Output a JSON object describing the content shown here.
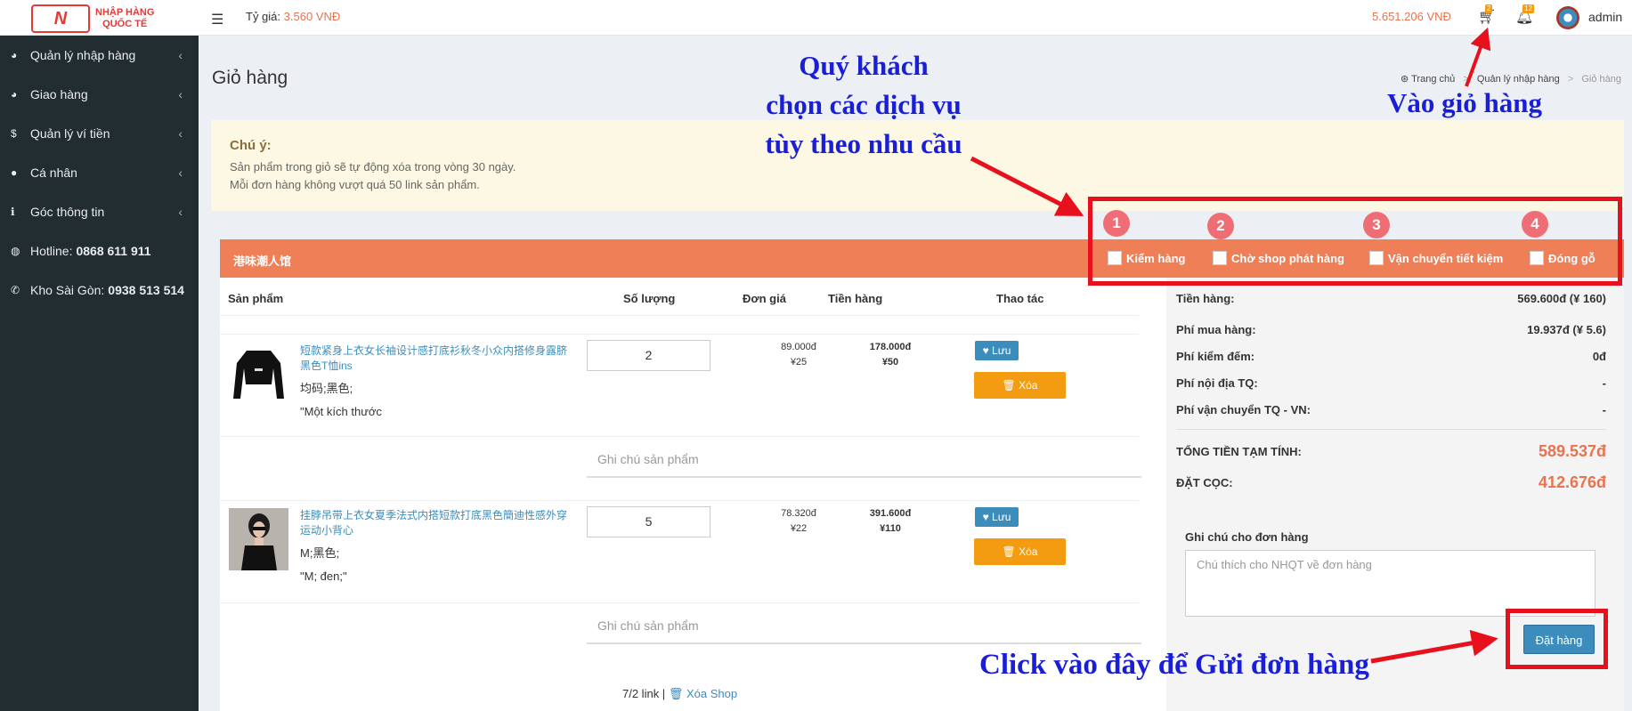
{
  "topbar": {
    "logo_mark": "N",
    "logo_text_line1": "NHẬP HÀNG",
    "logo_text_line2": "QUỐC TẾ",
    "rate_label": "Tỷ giá:",
    "rate_value": "3.560 VNĐ",
    "balance": "5.651.206 VNĐ",
    "cart_count": "2",
    "notif_count": "12",
    "user": "admin"
  },
  "sidebar": {
    "items": [
      {
        "icon": "chart-pie-icon",
        "label": "Quản lý nhập hàng",
        "glyph": "◕"
      },
      {
        "icon": "chart-pie-icon",
        "label": "Giao hàng",
        "glyph": "◕"
      },
      {
        "icon": "dollar-icon",
        "label": "Quản lý ví tiền",
        "glyph": "$"
      },
      {
        "icon": "user-icon",
        "label": "Cá nhân",
        "glyph": "●"
      },
      {
        "icon": "info-icon",
        "label": "Góc thông tin",
        "glyph": "ℹ"
      }
    ],
    "hotline_label": "Hotline:",
    "hotline_value": "0868 611 911",
    "kho_label": "Kho Sài Gòn:",
    "kho_value": "0938 513 514"
  },
  "page": {
    "title": "Giỏ hàng",
    "breadcrumb": [
      "Trang chủ",
      "Quản lý nhập hàng",
      "Giỏ hàng"
    ]
  },
  "notice": {
    "title": "Chú ý:",
    "line1": "Sản phẩm trong giỏ sẽ tự động xóa trong vòng 30 ngày.",
    "line2": "Mỗi đơn hàng không vượt quá 50 link sản phẩm."
  },
  "shop": {
    "name": "港味潮人馆",
    "services": [
      "Kiểm hàng",
      "Chờ shop phát hàng",
      "Vận chuyển tiết kiệm",
      "Đóng gỗ"
    ]
  },
  "table": {
    "headers": [
      "Sản phẩm",
      "Số lượng",
      "Đơn giá",
      "Tiền hàng",
      "Thao tác"
    ]
  },
  "items": [
    {
      "name": "短款紧身上衣女长袖设计感打底衫秋冬小众内搭修身露脐黑色T恤ins",
      "attr": "均码;黑色;",
      "note": "\"Một kích thước",
      "qty": "2",
      "price_vnd": "89.000đ",
      "price_cny": "¥25",
      "total_vnd": "178.000đ",
      "total_cny": "¥50",
      "save_label": "Lưu",
      "delete_label": "Xóa",
      "note_placeholder": "Ghi chú sản phẩm"
    },
    {
      "name": "挂脖吊带上衣女夏季法式内搭短款打底黑色簡迪性感外穿运动小背心",
      "attr": "M;黑色;",
      "note": "\"M; đen;\"",
      "qty": "5",
      "price_vnd": "78.320đ",
      "price_cny": "¥22",
      "total_vnd": "391.600đ",
      "total_cny": "¥110",
      "save_label": "Lưu",
      "delete_label": "Xóa",
      "note_placeholder": "Ghi chú sản phẩm"
    }
  ],
  "footer": {
    "links": "7/2 link |",
    "delete_shop": "Xóa Shop"
  },
  "summary": {
    "tien_hang_label": "Tiền hàng:",
    "tien_hang_value": "569.600đ (¥ 160)",
    "phi_mua_label": "Phí mua hàng:",
    "phi_mua_value": "19.937đ (¥ 5.6)",
    "phi_kiem_label": "Phí kiểm đếm:",
    "phi_kiem_value": "0đ",
    "phi_noi_dia_label": "Phí nội địa TQ:",
    "phi_noi_dia_value": "-",
    "phi_vc_label": "Phí vận chuyển TQ - VN:",
    "phi_vc_value": "-",
    "tong_label": "TỔNG TIỀN TẠM TÍNH:",
    "tong_value": "589.537đ",
    "coc_label": "ĐẶT CỌC:",
    "coc_value": "412.676đ",
    "order_note_label": "Ghi chú cho đơn hàng",
    "order_note_placeholder": "Chú thích cho NHQT về đơn hàng",
    "order_button": "Đặt hàng"
  },
  "annotations": {
    "choose_line1": "Quý khách",
    "choose_line2": "chọn các dịch vụ",
    "choose_line3": "tùy theo nhu cầu",
    "cart": "Vào giỏ hàng",
    "submit": "Click vào đây để Gửi đơn hàng",
    "numbers": [
      "1",
      "2",
      "3",
      "4"
    ]
  },
  "colors": {
    "accent": "#ef7f57",
    "sidebar": "#222d32",
    "annotation_blue": "#1a1fd6",
    "annotation_red": "#e8101c"
  }
}
